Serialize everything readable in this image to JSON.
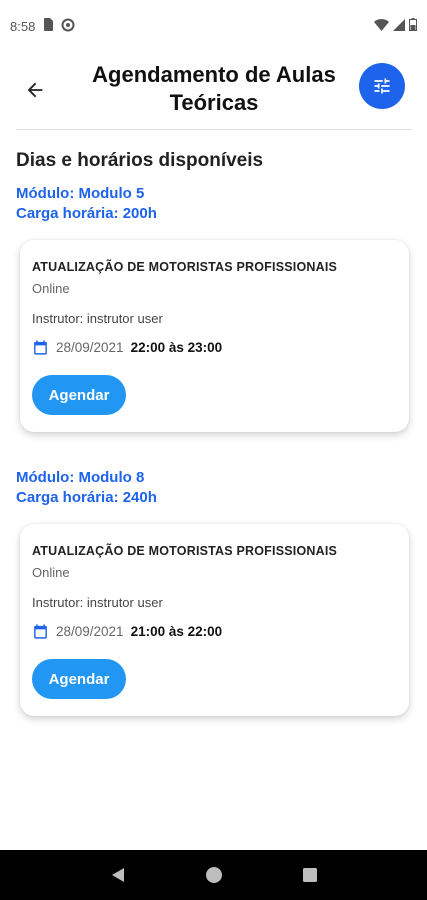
{
  "status_bar": {
    "time": "8:58"
  },
  "header": {
    "title": "Agendamento de Aulas Teóricas"
  },
  "section": {
    "title": "Dias e horários disponíveis"
  },
  "modules": [
    {
      "module": "Módulo: Modulo 5",
      "workload": "Carga horária: 200h",
      "course": "ATUALIZAÇÃO DE MOTORISTAS PROFISSIONAIS",
      "mode": "Online",
      "instructor": "Instrutor: instrutor user",
      "date": "28/09/2021",
      "time": "22:00 às 23:00",
      "button_label": "Agendar"
    },
    {
      "module": "Módulo: Modulo 8",
      "workload": "Carga horária: 240h",
      "course": "ATUALIZAÇÃO DE MOTORISTAS PROFISSIONAIS",
      "mode": "Online",
      "instructor": "Instrutor: instrutor user",
      "date": "28/09/2021",
      "time": "21:00 às 22:00",
      "button_label": "Agendar"
    }
  ],
  "colors": {
    "accent": "#1e63ec",
    "button": "#2196f3"
  },
  "icons": [
    "sim-card-icon",
    "sync-icon",
    "wifi-icon",
    "signal-icon",
    "battery-icon",
    "back-arrow-icon",
    "tune-icon",
    "calendar-icon",
    "nav-back-icon",
    "nav-home-icon",
    "nav-recents-icon"
  ]
}
